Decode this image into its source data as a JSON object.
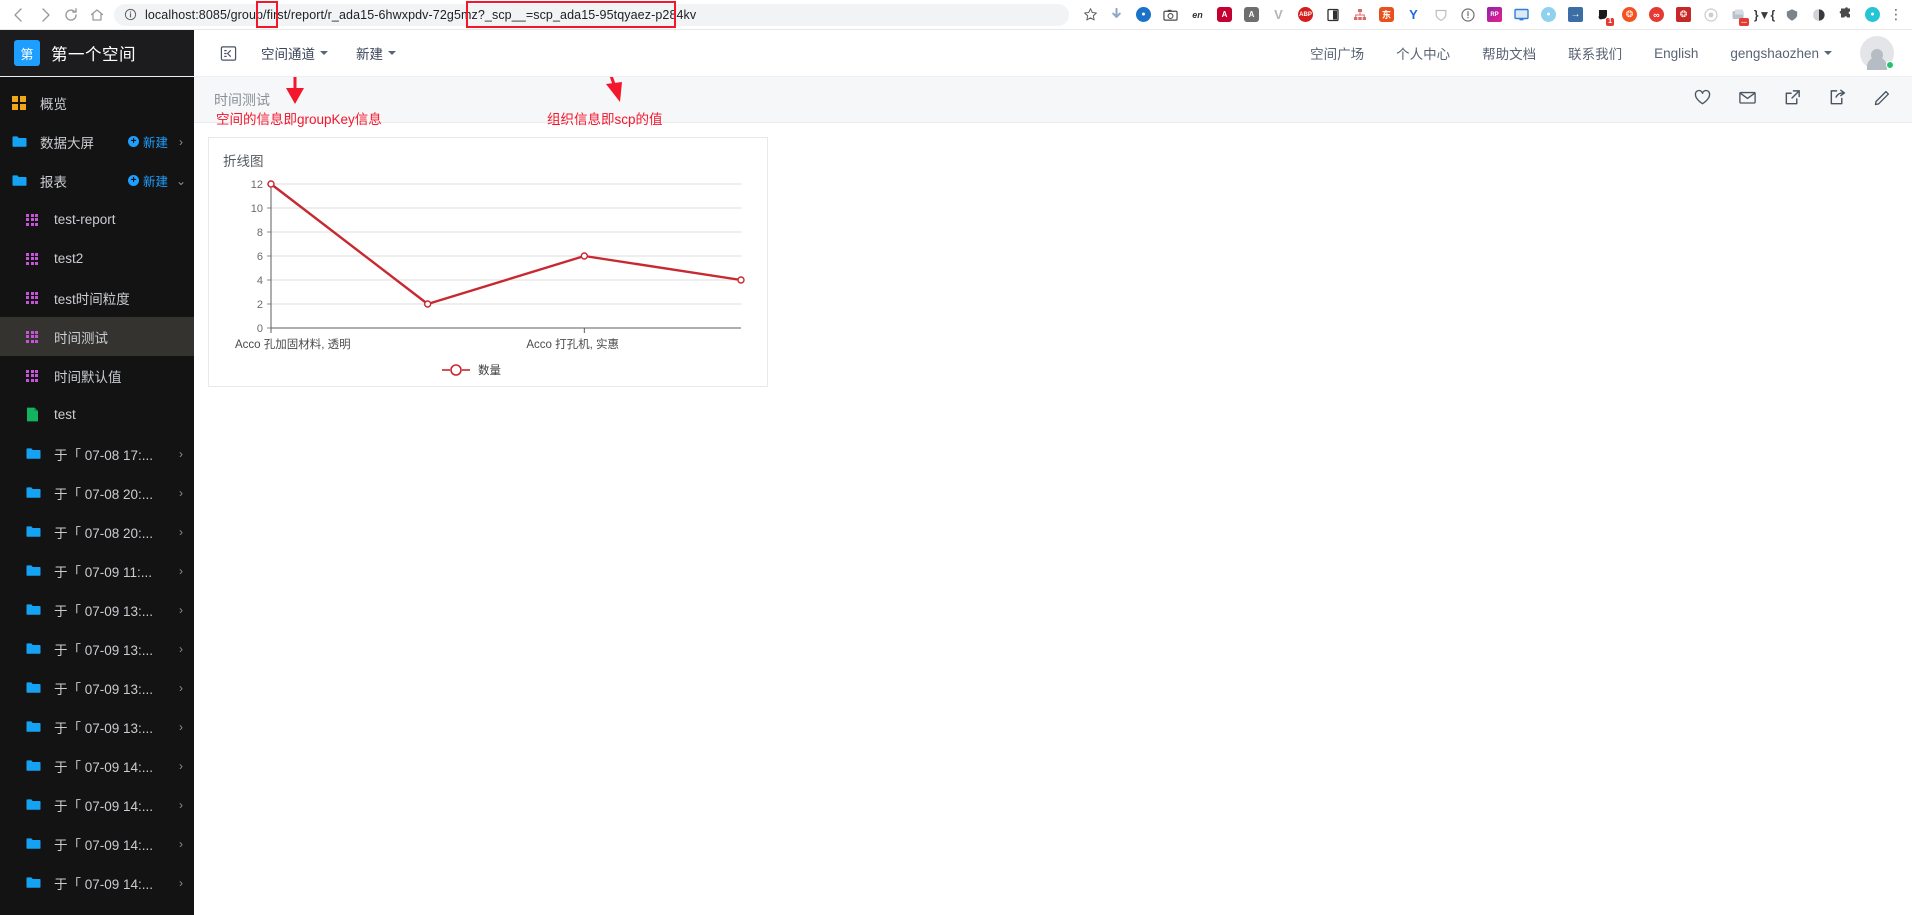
{
  "browser": {
    "back_icon": "back-arrow-icon",
    "forward_icon": "forward-arrow-icon",
    "reload_icon": "reload-icon",
    "home_icon": "home-icon",
    "info_icon": "site-info-icon",
    "url_full": "localhost:8085/group/first/report/r_ada15-6hwxpdv-72g5mz?_scp__=scp_ada15-95tqyaez-p284kv",
    "url_host": "localhost",
    "url_rest": ":8085/group/first/report/r_ada15-6hwxpdv-72g5mz?_scp__=scp_ada15-95tqyaez-p284kv",
    "bookmark_icon": "star-icon",
    "menu_icon": "kebab-menu-icon",
    "extension_badge": "1",
    "extensions": [
      {
        "name": "download-icon",
        "glyph": "⬇",
        "color": "#8fa9c4"
      },
      {
        "name": "opera-ext-icon",
        "glyph": "●",
        "color": "#1a73c8"
      },
      {
        "name": "screenshot-camera-icon",
        "glyph": "⬛",
        "color": "#5a5a5a"
      },
      {
        "name": "translate-en-icon",
        "glyph": "en",
        "color": "#444444"
      },
      {
        "name": "angular-a-red-icon",
        "glyph": "A",
        "color": "#c3002f"
      },
      {
        "name": "angular-a-gray-icon",
        "glyph": "A",
        "color": "#6e6e6e"
      },
      {
        "name": "vue-v-icon",
        "glyph": "V",
        "color": "#aeb6bd"
      },
      {
        "name": "adblock-plus-icon",
        "glyph": "ABP",
        "color": "#d41e1e"
      },
      {
        "name": "reader-panel-icon",
        "glyph": "▧",
        "color": "#303030"
      },
      {
        "name": "sitemap-icon",
        "glyph": "⛓",
        "color": "#d96a6a"
      },
      {
        "name": "taobao-ext-icon",
        "glyph": "东",
        "color": "#e8501c"
      },
      {
        "name": "yandex-y-icon",
        "glyph": "Y",
        "color": "#1e6ae0"
      },
      {
        "name": "shield-outline-icon",
        "glyph": "▽",
        "color": "#b9bfc6"
      },
      {
        "name": "exclamation-circle-icon",
        "glyph": "!",
        "color": "#707070"
      },
      {
        "name": "rp-purple-icon",
        "glyph": "RP",
        "color": "#9c27b0"
      },
      {
        "name": "monitor-blue-icon",
        "glyph": "▤",
        "color": "#2f7fd6"
      },
      {
        "name": "globe-ext-icon",
        "glyph": "●",
        "color": "#7fc4e8"
      },
      {
        "name": "arrow-right-blue-icon",
        "glyph": "→",
        "color": "#3a6ea5"
      },
      {
        "name": "dark-circle-badge-icon",
        "glyph": "●",
        "color": "#1b1b1b"
      },
      {
        "name": "lifebuoy-orange-icon",
        "glyph": "❂",
        "color": "#f4511e"
      },
      {
        "name": "infinity-red-icon",
        "glyph": "∞",
        "color": "#e53935"
      },
      {
        "name": "spider-red-icon",
        "glyph": "✲",
        "color": "#c62828"
      },
      {
        "name": "target-gray-icon",
        "glyph": "◎",
        "color": "#c8cdd2"
      },
      {
        "name": "note-folder-icon",
        "glyph": "▣",
        "color": "#9aa4ad"
      },
      {
        "name": "bracket-v-icon",
        "glyph": "⌶",
        "color": "#3b3b3b"
      },
      {
        "name": "shield-gray-icon",
        "glyph": "⬟",
        "color": "#7b848c"
      },
      {
        "name": "moon-icon",
        "glyph": "◐",
        "color": "#3a3a3a"
      },
      {
        "name": "puzzle-piece-icon",
        "glyph": "❖",
        "color": "#4a4a4a"
      },
      {
        "name": "profile-avatar-icon",
        "glyph": "●",
        "color": "#27c4d6"
      }
    ]
  },
  "header": {
    "logo_char": "第",
    "workspace_name": "第一个空间",
    "collapse_icon": "collapse-sidebar-icon",
    "menu_channel": "空间通道",
    "menu_new": "新建",
    "nav_links": [
      "空间广场",
      "个人中心",
      "帮助文档",
      "联系我们",
      "English"
    ],
    "username": "gengshaozhen",
    "avatar_icon": "user-avatar-icon"
  },
  "sidebar": {
    "items": [
      {
        "label": "概览",
        "icon": "dashboard-grid-icon",
        "type": "overview",
        "indent": 0,
        "active": false,
        "new_label": "",
        "chevron": ""
      },
      {
        "label": "数据大屏",
        "icon": "folder-icon",
        "type": "folder",
        "indent": 0,
        "active": false,
        "new_label": "新建",
        "chevron": "›"
      },
      {
        "label": "报表",
        "icon": "folder-icon",
        "type": "folder",
        "indent": 0,
        "active": false,
        "new_label": "新建",
        "chevron": "⌄"
      },
      {
        "label": "test-report",
        "icon": "report-grid-icon",
        "type": "report",
        "indent": 1,
        "active": false,
        "new_label": "",
        "chevron": ""
      },
      {
        "label": "test2",
        "icon": "report-grid-icon",
        "type": "report",
        "indent": 1,
        "active": false,
        "new_label": "",
        "chevron": ""
      },
      {
        "label": "test时间粒度",
        "icon": "report-grid-icon",
        "type": "report",
        "indent": 1,
        "active": false,
        "new_label": "",
        "chevron": ""
      },
      {
        "label": "时间测试",
        "icon": "report-grid-icon",
        "type": "report",
        "indent": 1,
        "active": true,
        "new_label": "",
        "chevron": ""
      },
      {
        "label": "时间默认值",
        "icon": "report-grid-icon",
        "type": "report",
        "indent": 1,
        "active": false,
        "new_label": "",
        "chevron": ""
      },
      {
        "label": "test",
        "icon": "sheet-green-icon",
        "type": "sheet",
        "indent": 1,
        "active": false,
        "new_label": "",
        "chevron": ""
      },
      {
        "label": "于「 07-08 17:...",
        "icon": "folder-icon",
        "type": "folder",
        "indent": 1,
        "active": false,
        "new_label": "",
        "chevron": "›"
      },
      {
        "label": "于「 07-08 20:...",
        "icon": "folder-icon",
        "type": "folder",
        "indent": 1,
        "active": false,
        "new_label": "",
        "chevron": "›"
      },
      {
        "label": "于「 07-08 20:...",
        "icon": "folder-icon",
        "type": "folder",
        "indent": 1,
        "active": false,
        "new_label": "",
        "chevron": "›"
      },
      {
        "label": "于「 07-09 11:...",
        "icon": "folder-icon",
        "type": "folder",
        "indent": 1,
        "active": false,
        "new_label": "",
        "chevron": "›"
      },
      {
        "label": "于「 07-09 13:...",
        "icon": "folder-icon",
        "type": "folder",
        "indent": 1,
        "active": false,
        "new_label": "",
        "chevron": "›"
      },
      {
        "label": "于「 07-09 13:...",
        "icon": "folder-icon",
        "type": "folder",
        "indent": 1,
        "active": false,
        "new_label": "",
        "chevron": "›"
      },
      {
        "label": "于「 07-09 13:...",
        "icon": "folder-icon",
        "type": "folder",
        "indent": 1,
        "active": false,
        "new_label": "",
        "chevron": "›"
      },
      {
        "label": "于「 07-09 13:...",
        "icon": "folder-icon",
        "type": "folder",
        "indent": 1,
        "active": false,
        "new_label": "",
        "chevron": "›"
      },
      {
        "label": "于「 07-09 14:...",
        "icon": "folder-icon",
        "type": "folder",
        "indent": 1,
        "active": false,
        "new_label": "",
        "chevron": "›"
      },
      {
        "label": "于「 07-09 14:...",
        "icon": "folder-icon",
        "type": "folder",
        "indent": 1,
        "active": false,
        "new_label": "",
        "chevron": "›"
      },
      {
        "label": "于「 07-09 14:...",
        "icon": "folder-icon",
        "type": "folder",
        "indent": 1,
        "active": false,
        "new_label": "",
        "chevron": "›"
      },
      {
        "label": "于「 07-09 14:...",
        "icon": "folder-icon",
        "type": "folder",
        "indent": 1,
        "active": false,
        "new_label": "",
        "chevron": "›"
      }
    ]
  },
  "page": {
    "title": "时间测试",
    "actions": [
      {
        "name": "favorite-heart-icon"
      },
      {
        "name": "mail-icon"
      },
      {
        "name": "open-external-icon"
      },
      {
        "name": "share-icon"
      },
      {
        "name": "edit-pencil-icon"
      }
    ]
  },
  "annotations": [
    {
      "text": "空间的信息即groupKey信息",
      "color": "#f4172c"
    },
    {
      "text": "组织信息即scp的值",
      "color": "#f4172c"
    }
  ],
  "chart_data": {
    "type": "line",
    "title": "折线图",
    "xlabel": "",
    "ylabel": "",
    "ylim": [
      0,
      12
    ],
    "yticks": [
      0,
      2,
      4,
      6,
      8,
      10,
      12
    ],
    "grid": true,
    "legend_position": "bottom",
    "categories": [
      "Acco 孔加固材料, 透明",
      "",
      "Acco 打孔机, 实惠",
      ""
    ],
    "xtick_labels": [
      "Acco 孔加固材料, 透明",
      "Acco 打孔机, 实惠"
    ],
    "series": [
      {
        "name": "数量",
        "color": "#c8282f",
        "values": [
          12,
          2,
          6,
          4
        ]
      }
    ]
  }
}
